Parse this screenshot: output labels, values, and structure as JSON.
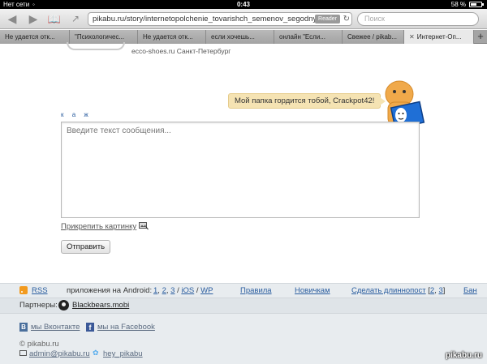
{
  "status_bar": {
    "carrier": "Нет сети",
    "time": "0:43",
    "battery_pct": "58 %",
    "battery_level": 0.58
  },
  "toolbar": {
    "url": "pikabu.ru/story/internetopolchenie_tovarishch_semenov_segodnya_v",
    "reader_label": "Reader",
    "search_placeholder": "Поиск"
  },
  "tabs": [
    {
      "label": "Не удается отк..."
    },
    {
      "label": "\"Психологичес..."
    },
    {
      "label": "Не удается отк..."
    },
    {
      "label": "если хочешь..."
    },
    {
      "label": "онлайн \"Если..."
    },
    {
      "label": "Свежее / pikab..."
    },
    {
      "label": "Интернет-Оп...",
      "active": true
    }
  ],
  "page": {
    "shop_info": "ecco-shoes.ru  Санкт-Петербург",
    "speech": "Мой папка гордится тобой, Crackpot42!",
    "format_links": [
      "к",
      "а",
      "ж"
    ],
    "message_placeholder": "Введите текст сообщения...",
    "attach_label": "Прикрепить картинку",
    "send_label": "Отправить"
  },
  "footer": {
    "rss": "RSS",
    "apps_label": "приложения на Android:",
    "android_versions": [
      "1",
      "2",
      "3"
    ],
    "ios": "iOS",
    "wp": "WP",
    "rules": "Правила",
    "newbies": "Новичкам",
    "longpost": "Сделать длиннопост",
    "longpost_nums": [
      "2",
      "3"
    ],
    "ban": "Бан",
    "partners_label": "Партнеры:",
    "partner": "Blackbears.mobi",
    "vk": "мы Вконтакте",
    "fb": "мы на Facebook",
    "copyright": "© pikabu.ru",
    "email": "admin@pikabu.ru",
    "twitter": "hey_pikabu"
  },
  "watermark": "pikabu.ru"
}
